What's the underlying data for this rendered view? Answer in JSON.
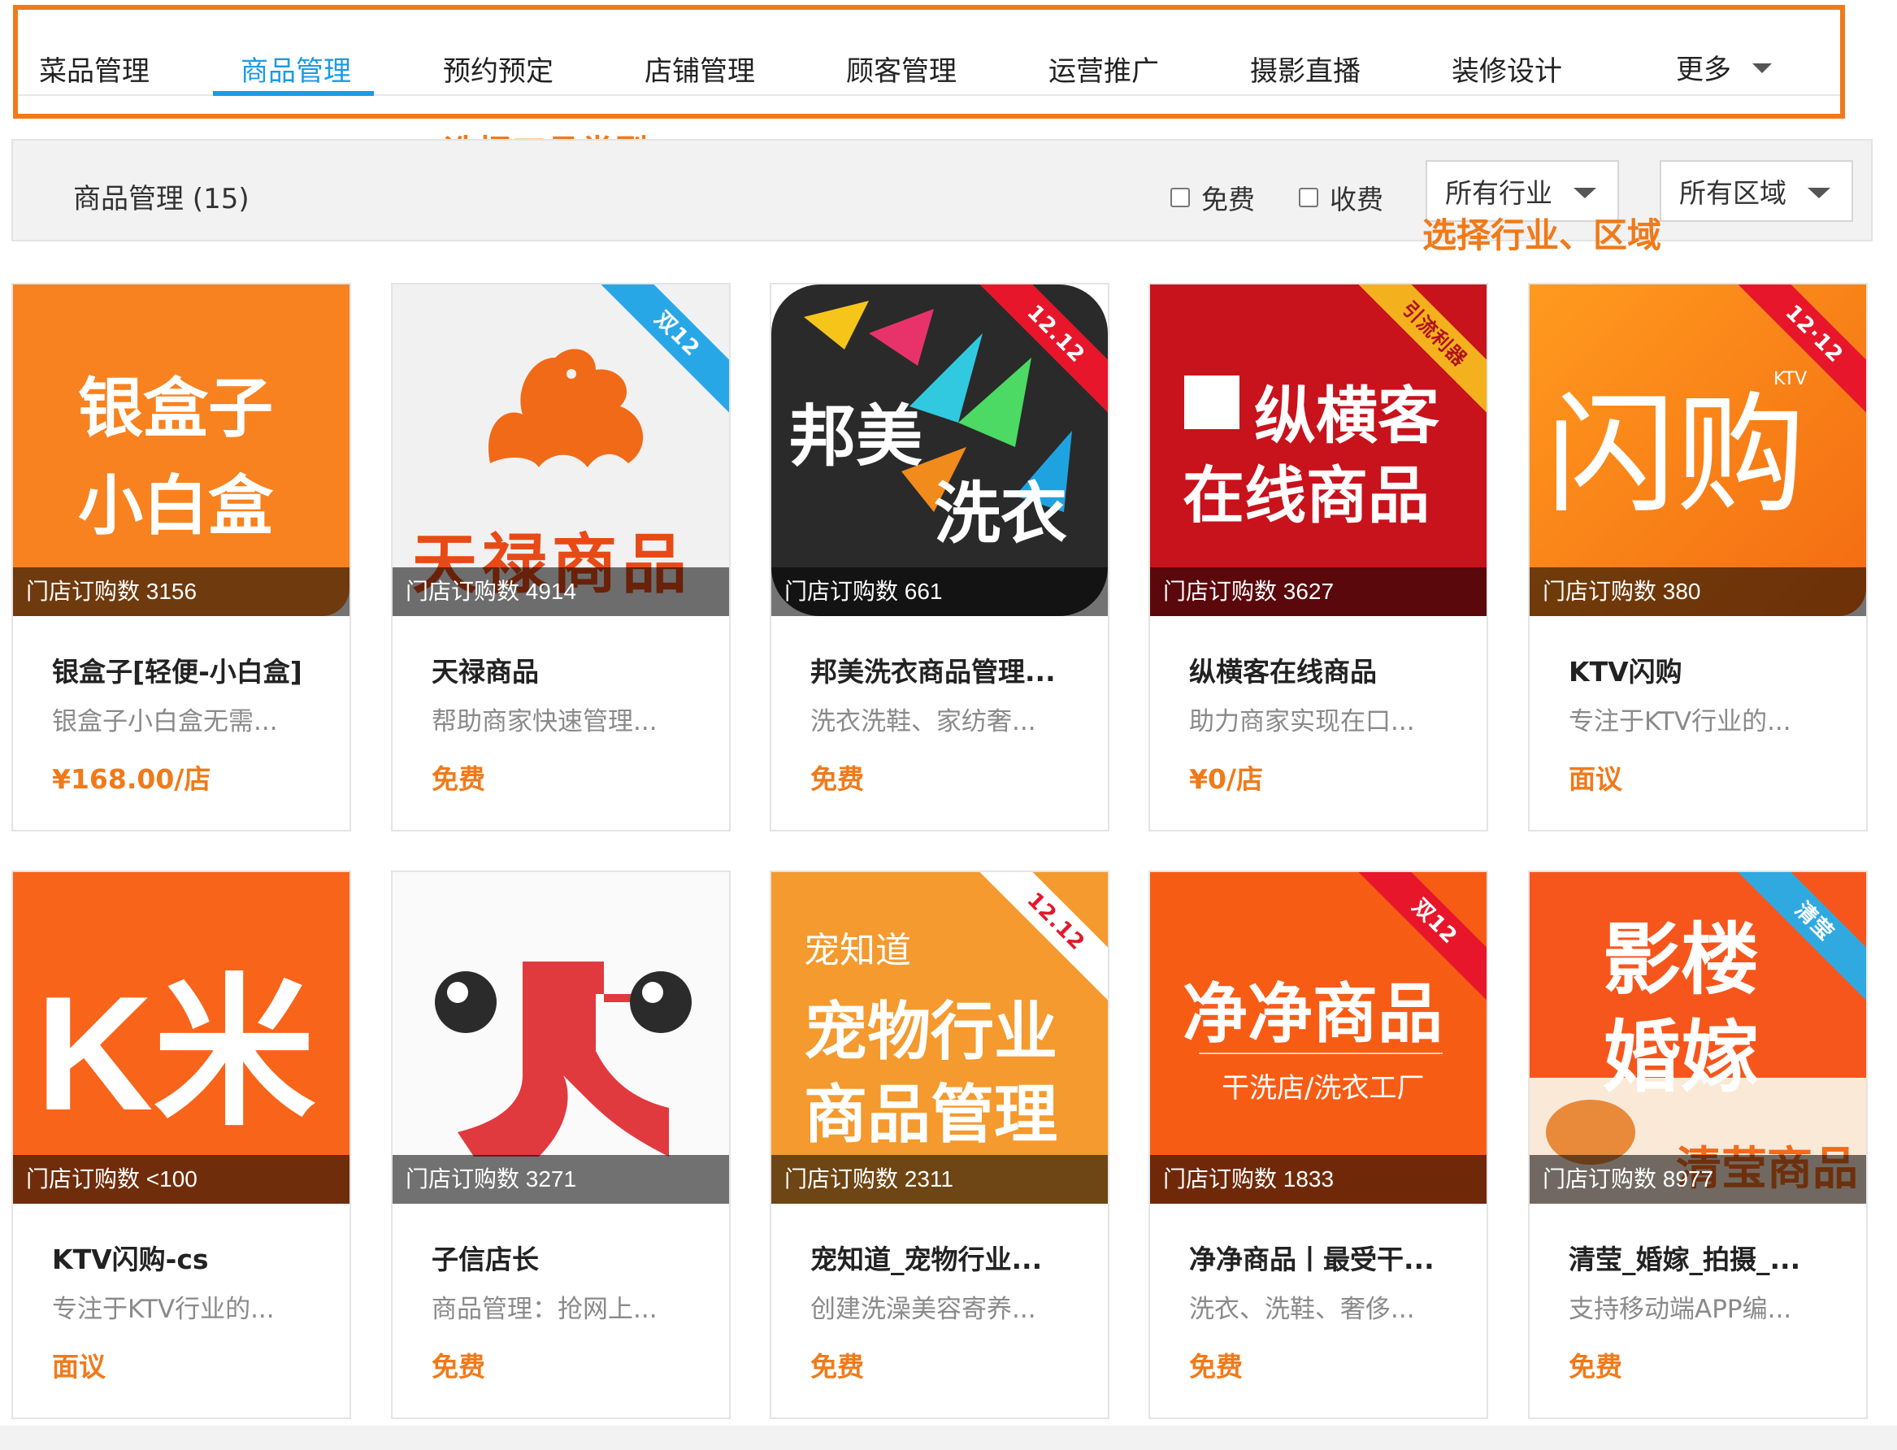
{
  "tabs": [
    {
      "label": "菜品管理"
    },
    {
      "label": "商品管理"
    },
    {
      "label": "预约预定"
    },
    {
      "label": "店铺管理"
    },
    {
      "label": "顾客管理"
    },
    {
      "label": "运营推广"
    },
    {
      "label": "摄影直播"
    },
    {
      "label": "装修设计"
    },
    {
      "label": "更多"
    }
  ],
  "annotations": {
    "tool_type": "选择工具类型",
    "industry_region": "选择行业、区域"
  },
  "filter": {
    "title": "商品管理 (15)",
    "free_label": "免费",
    "paid_label": "收费",
    "industry_select": "所有行业",
    "region_select": "所有区域"
  },
  "colors": {
    "accent_orange": "#f07a1a",
    "active_blue": "#1a9be6"
  },
  "cards": [
    {
      "title": "银盒子[轻便-小白盒]",
      "desc": "银盒子小白盒无需...",
      "price": "¥168.00/店",
      "orders": "门店订购数 3156",
      "logo": [
        "银盒子",
        "小白盒"
      ],
      "ribbon": ""
    },
    {
      "title": "天禄商品",
      "desc": "帮助商家快速管理...",
      "price": "免费",
      "orders": "门店订购数 4914",
      "logo": [
        "天禄商品"
      ],
      "ribbon": "双12"
    },
    {
      "title": "邦美洗衣商品管理...",
      "desc": "洗衣洗鞋、家纺奢...",
      "price": "免费",
      "orders": "门店订购数 661",
      "logo": [
        "邦美",
        "洗衣"
      ],
      "ribbon": "12.12"
    },
    {
      "title": "纵横客在线商品",
      "desc": "助力商家实现在口...",
      "price": "¥0/店",
      "orders": "门店订购数 3627",
      "logo": [
        "纵横客",
        "在线商品"
      ],
      "ribbon": "引流利器"
    },
    {
      "title": "KTV闪购",
      "desc": "专注于KTV行业的...",
      "price": "面议",
      "orders": "门店订购数 380",
      "logo": [
        "闪购",
        "KTV"
      ],
      "ribbon": "12·12"
    },
    {
      "title": "KTV闪购-cs",
      "desc": "专注于KTV行业的...",
      "price": "面议",
      "orders": "门店订购数 <100",
      "logo": [
        "K米"
      ],
      "ribbon": ""
    },
    {
      "title": "子信店长",
      "desc": "商品管理：抢网上...",
      "price": "免费",
      "orders": "门店订购数 3271",
      "logo": [],
      "ribbon": ""
    },
    {
      "title": "宠知道_宠物行业...",
      "desc": "创建洗澡美容寄养...",
      "price": "免费",
      "orders": "门店订购数 2311",
      "logo": [
        "宠知道",
        "宠物行业",
        "商品管理"
      ],
      "ribbon": "12.12"
    },
    {
      "title": "净净商品丨最受干...",
      "desc": "洗衣、洗鞋、奢侈...",
      "price": "免费",
      "orders": "门店订购数 1833",
      "logo": [
        "净净商品",
        "干洗店/洗衣工厂"
      ],
      "ribbon": "双12"
    },
    {
      "title": "清莹_婚嫁_拍摄_...",
      "desc": "支持移动端APP编...",
      "price": "免费",
      "orders": "门店订购数 8977",
      "logo": [
        "影楼",
        "婚嫁",
        "清莹商品"
      ],
      "ribbon": "清莹"
    }
  ]
}
